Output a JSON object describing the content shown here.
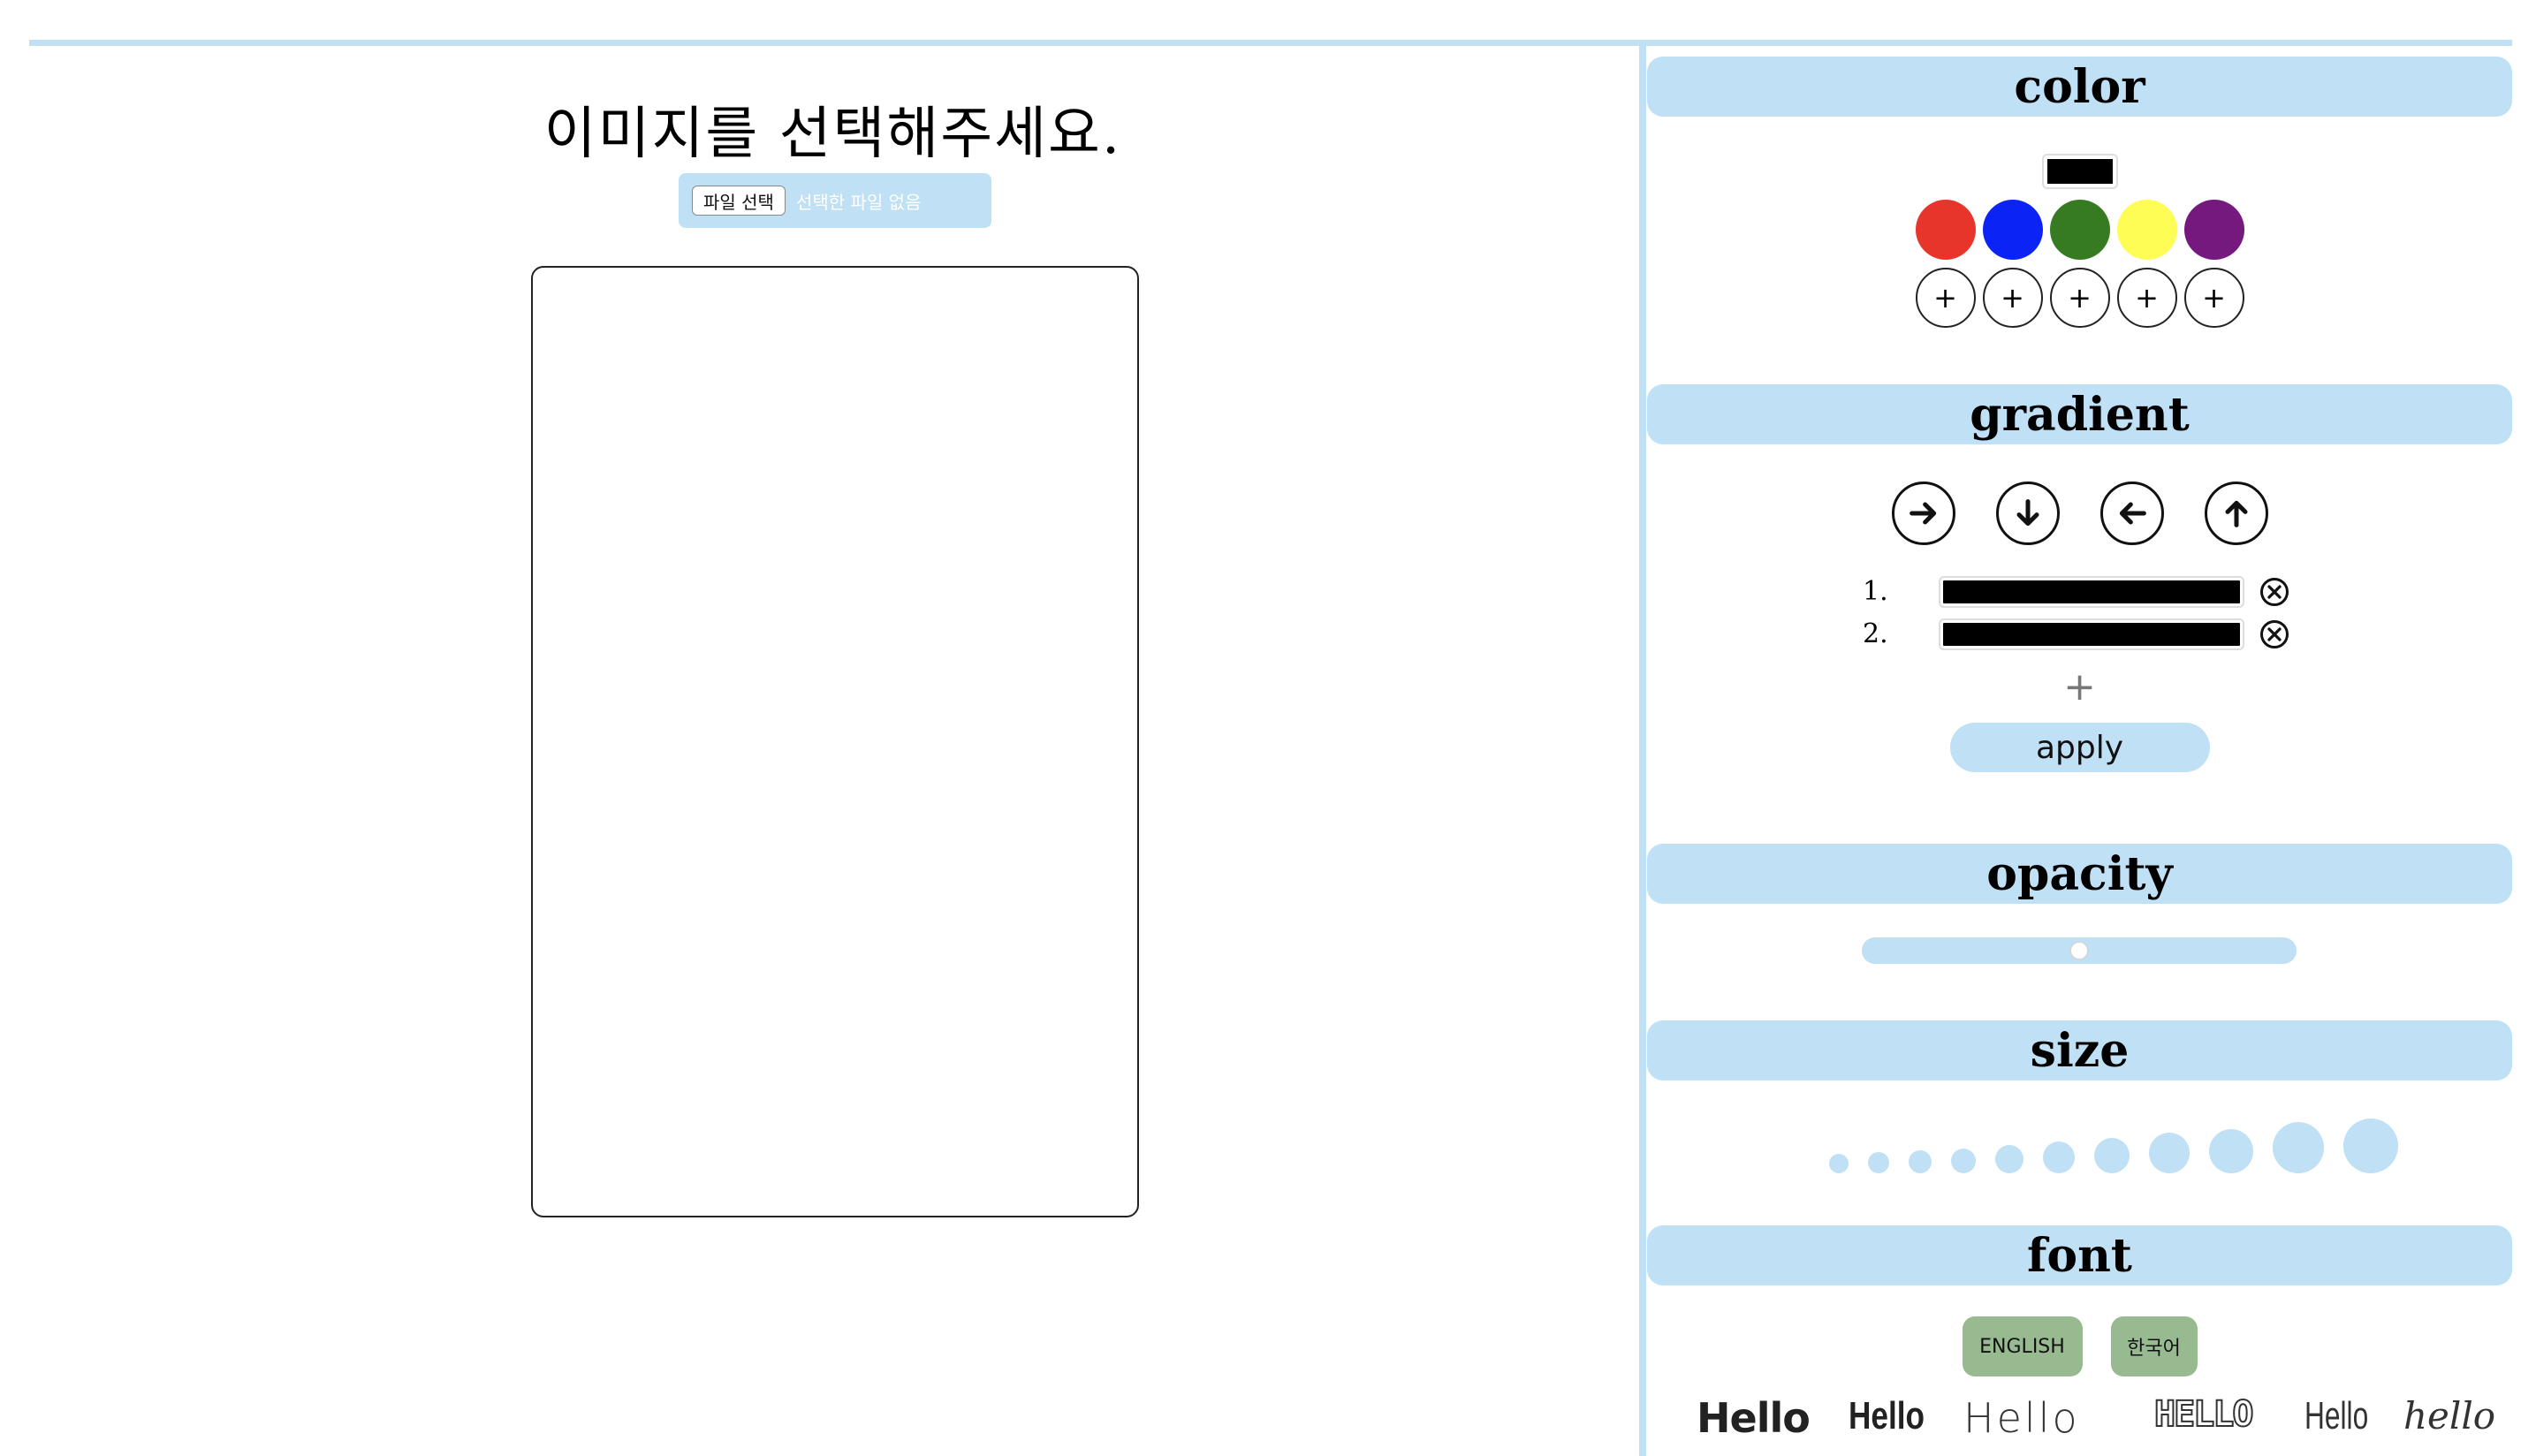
{
  "left": {
    "title": "이미지를 선택해주세요.",
    "file_button_label": "파일 선택",
    "file_status": "선택한 파일 없음"
  },
  "panel": {
    "color": {
      "title": "color",
      "current_color": "#000000",
      "swatches": [
        {
          "name": "red",
          "hex": "#e8352b"
        },
        {
          "name": "blue",
          "hex": "#0b24f5"
        },
        {
          "name": "green",
          "hex": "#367b22"
        },
        {
          "name": "yellow",
          "hex": "#fdfd56"
        },
        {
          "name": "purple",
          "hex": "#75197e"
        }
      ],
      "add_slots": [
        "+",
        "+",
        "+",
        "+",
        "+"
      ]
    },
    "gradient": {
      "title": "gradient",
      "directions": [
        "arrow-right-icon",
        "arrow-down-icon",
        "arrow-left-icon",
        "arrow-up-icon"
      ],
      "stops": [
        {
          "label": "1.",
          "color": "#000000"
        },
        {
          "label": "2.",
          "color": "#000000"
        }
      ],
      "add_label": "+",
      "apply_label": "apply"
    },
    "opacity": {
      "title": "opacity",
      "value": 0.5
    },
    "size": {
      "title": "size",
      "options_count": 11
    },
    "font": {
      "title": "font",
      "languages": [
        "ENGLISH",
        "한국어"
      ],
      "samples": [
        "Hello",
        "Hello",
        "Hello",
        "HELLO",
        "Hello",
        "hello"
      ]
    }
  },
  "colors": {
    "accent": "#bfe0f5",
    "lang_button": "#98ba91"
  }
}
